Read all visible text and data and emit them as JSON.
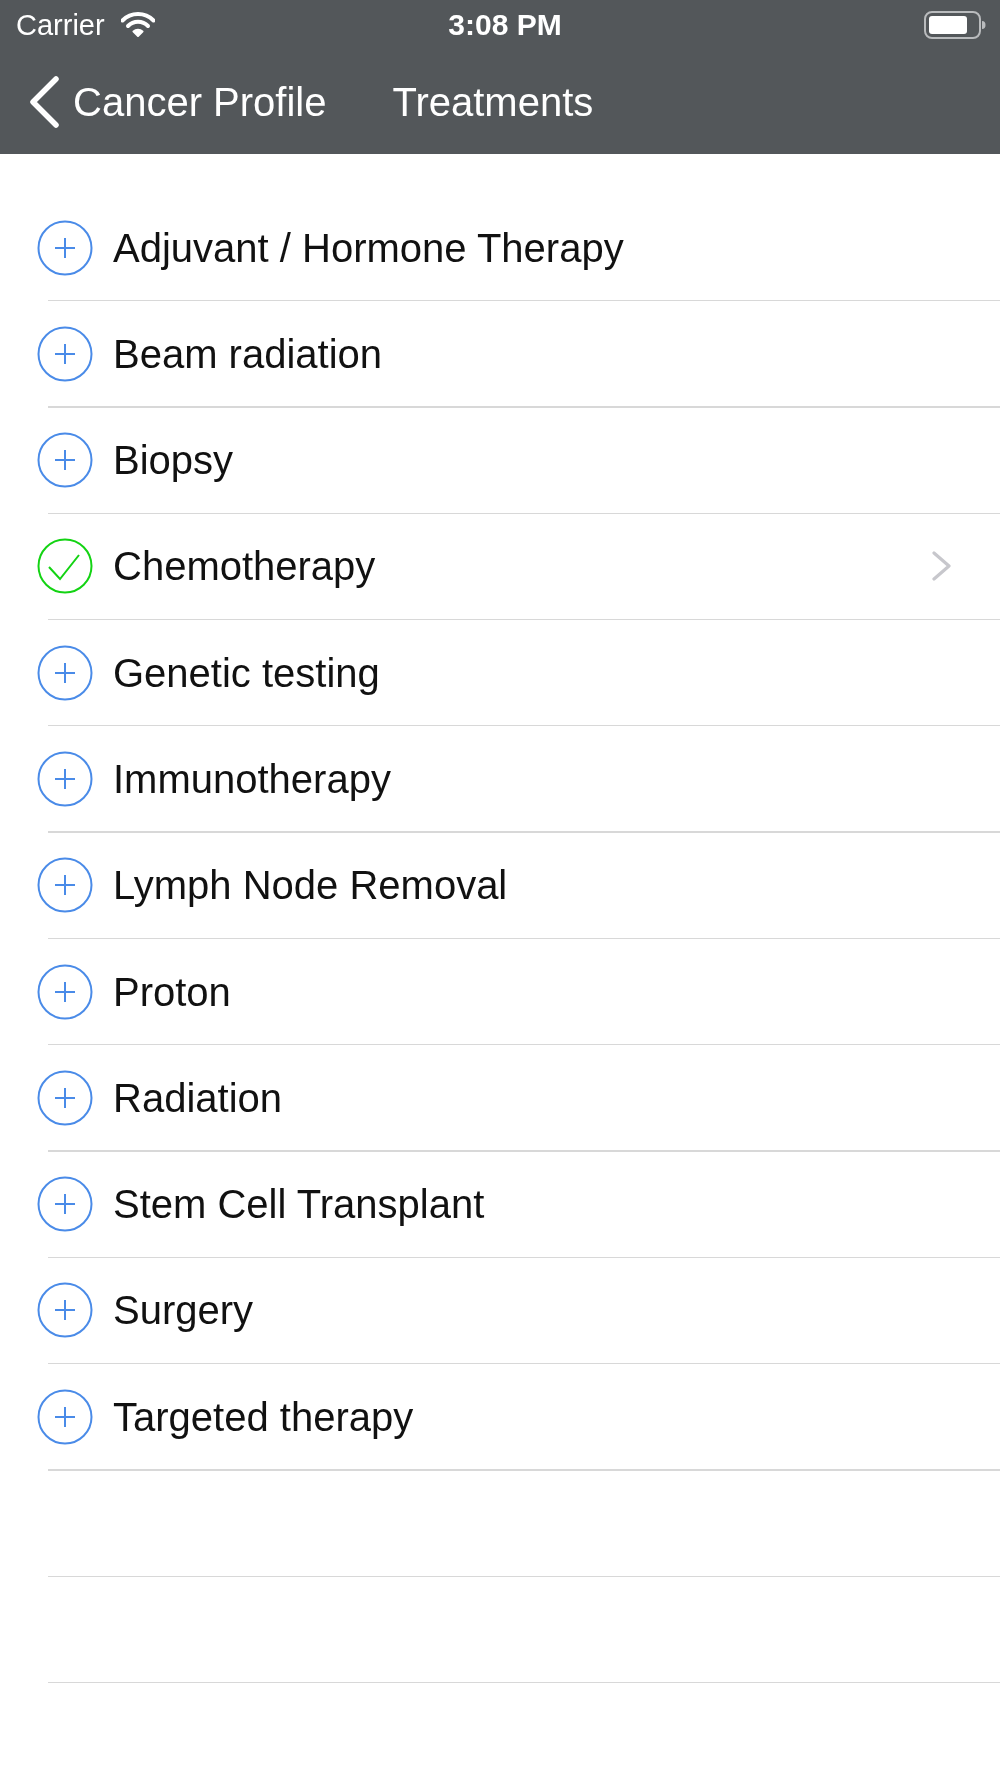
{
  "status_bar": {
    "carrier": "Carrier",
    "time": "3:08 PM"
  },
  "nav_bar": {
    "back_label": "Cancer Profile",
    "title": "Treatments"
  },
  "treatments": [
    {
      "name": "Adjuvant / Hormone Therapy",
      "checked": false
    },
    {
      "name": "Beam radiation",
      "checked": false
    },
    {
      "name": "Biopsy",
      "checked": false
    },
    {
      "name": "Chemotherapy",
      "checked": true
    },
    {
      "name": "Genetic testing",
      "checked": false
    },
    {
      "name": "Immunotherapy",
      "checked": false
    },
    {
      "name": "Lymph Node Removal",
      "checked": false
    },
    {
      "name": "Proton",
      "checked": false
    },
    {
      "name": "Radiation",
      "checked": false
    },
    {
      "name": "Stem Cell Transplant",
      "checked": false
    },
    {
      "name": "Surgery",
      "checked": false
    },
    {
      "name": "Targeted therapy",
      "checked": false
    }
  ]
}
